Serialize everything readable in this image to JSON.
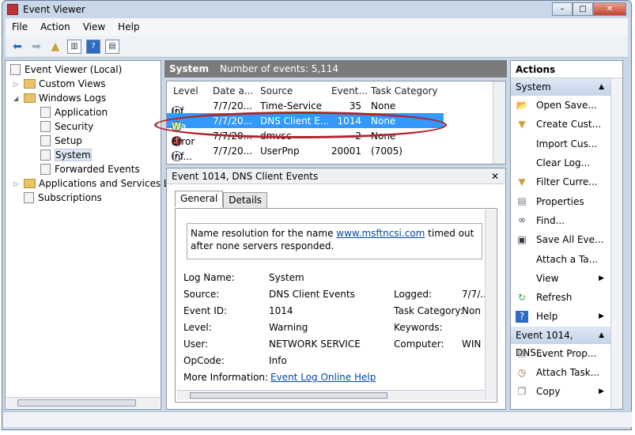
{
  "window": {
    "title": "Event Viewer",
    "buttons": {
      "minimize": "–",
      "maximize": "□",
      "close": "✕"
    }
  },
  "menu": [
    "File",
    "Action",
    "View",
    "Help"
  ],
  "tree": {
    "root": "Event Viewer (Local)",
    "custom_views": "Custom Views",
    "windows_logs": "Windows Logs",
    "logs": [
      "Application",
      "Security",
      "Setup",
      "System",
      "Forwarded Events"
    ],
    "apps_services": "Applications and Services Lo",
    "subscriptions": "Subscriptions",
    "selected": "System"
  },
  "center": {
    "title": "System",
    "count": "Number of events: 5,114",
    "columns": [
      "Level",
      "Date a...",
      "Source",
      "Event...",
      "Task Category"
    ],
    "rows": [
      {
        "level": "Inf",
        "icon": "info",
        "date": "7/7/20...",
        "source": "Time-Service",
        "id": "35",
        "task": "None"
      },
      {
        "level": "Wa...",
        "icon": "warning",
        "date": "7/7/20...",
        "source": "DNS Client E...",
        "id": "1014",
        "task": "None",
        "selected": true
      },
      {
        "level": "Error",
        "icon": "error",
        "date": "7/7/20...",
        "source": "dmvsc",
        "id": "2",
        "task": "None"
      },
      {
        "level": "Inf...",
        "icon": "info",
        "date": "7/7/20...",
        "source": "UserPnp",
        "id": "20001",
        "task": "(7005)"
      }
    ]
  },
  "detail": {
    "title": "Event 1014, DNS Client Events",
    "tabs": [
      "General",
      "Details"
    ],
    "message_pre": "Name resolution for the name ",
    "message_link": "www.msftncsi.com",
    "message_post": " timed out after none servers responded.",
    "fields": {
      "log_name_l": "Log Name:",
      "log_name": "System",
      "source_l": "Source:",
      "source": "DNS Client Events",
      "logged_l": "Logged:",
      "logged": "7/7/...",
      "event_id_l": "Event ID:",
      "event_id": "1014",
      "task_l": "Task Category:",
      "task": "Non",
      "level_l": "Level:",
      "level": "Warning",
      "keywords_l": "Keywords:",
      "user_l": "User:",
      "user": "NETWORK SERVICE",
      "computer_l": "Computer:",
      "computer": "WIN",
      "opcode_l": "OpCode:",
      "opcode": "Info",
      "more_l": "More Information:",
      "more_link": "Event Log Online Help"
    }
  },
  "actions": {
    "title": "Actions",
    "section1": "System",
    "items1": [
      {
        "label": "Open Save...",
        "icon": "folder"
      },
      {
        "label": "Create Cust...",
        "icon": "filter"
      },
      {
        "label": "Import Cus...",
        "icon": ""
      },
      {
        "label": "Clear Log...",
        "icon": ""
      },
      {
        "label": "Filter Curre...",
        "icon": "filter"
      },
      {
        "label": "Properties",
        "icon": "properties"
      },
      {
        "label": "Find...",
        "icon": "binoculars"
      },
      {
        "label": "Save All Eve...",
        "icon": "save"
      },
      {
        "label": "Attach a Ta...",
        "icon": ""
      },
      {
        "label": "View",
        "icon": "",
        "submenu": true
      },
      {
        "label": "Refresh",
        "icon": "refresh"
      },
      {
        "label": "Help",
        "icon": "help",
        "submenu": true
      }
    ],
    "section2": "Event 1014, DNS...",
    "items2": [
      {
        "label": "Event Prop...",
        "icon": "properties"
      },
      {
        "label": "Attach Task...",
        "icon": "task"
      },
      {
        "label": "Copy",
        "icon": "copy",
        "submenu": true
      }
    ]
  },
  "colors": {
    "selection": "#3399ff",
    "annotation": "#b0242c",
    "header": "#7b7b7b"
  }
}
